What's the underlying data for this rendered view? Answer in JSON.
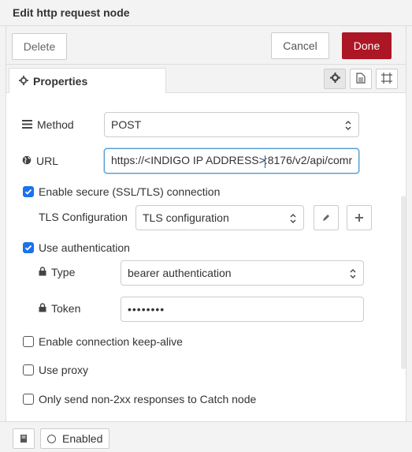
{
  "header": {
    "title": "Edit http request node"
  },
  "toolbar": {
    "delete_label": "Delete",
    "cancel_label": "Cancel",
    "done_label": "Done"
  },
  "tabs": {
    "properties_label": "Properties"
  },
  "form": {
    "method": {
      "label": "Method",
      "value": "POST"
    },
    "url": {
      "label": "URL",
      "value_before_cursor": "https://<INDIGO IP ADDRESS>",
      "value_after_cursor": ":8176/v2/api/comr"
    },
    "tls": {
      "checkbox_label": "Enable secure (SSL/TLS) connection",
      "checked": true,
      "config_label": "TLS Configuration",
      "config_value": "TLS configuration"
    },
    "auth": {
      "checkbox_label": "Use authentication",
      "checked": true,
      "type_label": "Type",
      "type_value": "bearer authentication",
      "token_label": "Token",
      "token_value": "••••••••"
    },
    "keepalive": {
      "label": "Enable connection keep-alive",
      "checked": false
    },
    "proxy": {
      "label": "Use proxy",
      "checked": false
    },
    "non2xx": {
      "label": "Only send non-2xx responses to Catch node",
      "checked": false
    }
  },
  "footer": {
    "enabled_label": "Enabled"
  },
  "colors": {
    "done": "#ad1625",
    "checkbox": "#1a73e8",
    "focus": "#4e9ad1"
  }
}
